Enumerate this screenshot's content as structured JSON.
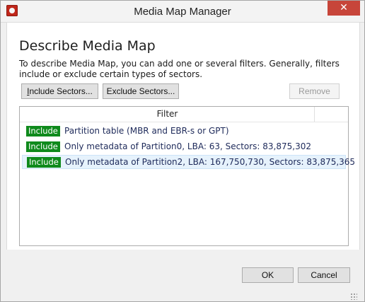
{
  "window": {
    "title": "Media Map Manager",
    "close_glyph": "✕"
  },
  "main": {
    "heading": "Describe Media Map",
    "description": "To describe Media Map, you can add one or several filters. Generally, filters include or exclude certain types of sectors."
  },
  "toolbar": {
    "include_label_underline": "I",
    "include_label_rest": "nclude Sectors...",
    "exclude_label": "Exclude Sectors...",
    "remove_label": "Remove"
  },
  "filter_list": {
    "column_header": "Filter",
    "rows": [
      {
        "type": "Include",
        "text": "Partition table (MBR and EBR-s or GPT)",
        "selected": false
      },
      {
        "type": "Include",
        "text": "Only metadata of Partition0, LBA: 63, Sectors: 83,875,302",
        "selected": false
      },
      {
        "type": "Include",
        "text": "Only metadata of Partition2, LBA: 167,750,730, Sectors: 83,875,365",
        "selected": true
      }
    ]
  },
  "footer": {
    "ok_label": "OK",
    "cancel_label": "Cancel"
  },
  "colors": {
    "include_badge": "#0f8a1c",
    "close_button": "#c7453a",
    "selection": "#e6f2fc"
  }
}
